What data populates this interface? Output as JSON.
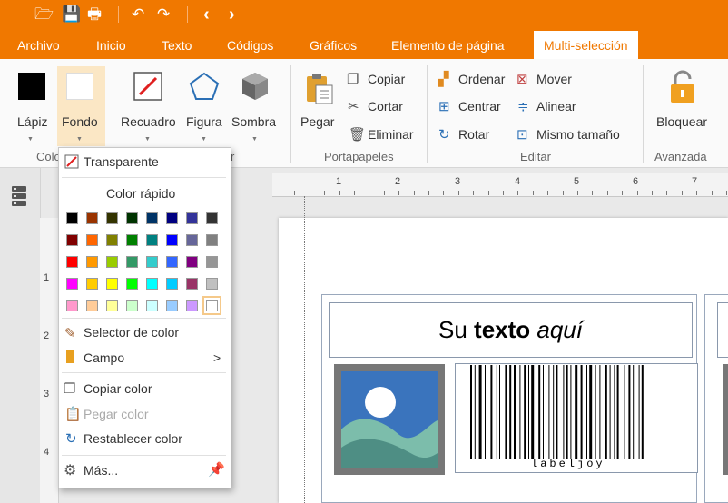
{
  "quick_access": {
    "icons": [
      "folder-open-icon",
      "save-icon",
      "print-icon",
      "undo-icon",
      "redo-icon",
      "back-icon",
      "forward-icon"
    ],
    "glyphs": [
      "🗁",
      "💾",
      "🖶",
      "↶",
      "↷",
      "‹",
      "›"
    ]
  },
  "tabs": [
    "Archivo",
    "Inicio",
    "Texto",
    "Códigos",
    "Gráficos",
    "Elemento de página",
    "Multi-selección"
  ],
  "ribbon": {
    "color_group": {
      "label": "Colo",
      "label_r": "r",
      "lapiz": "Lápiz",
      "fondo": "Fondo",
      "recuadro": "Recuadro",
      "figura": "Figura",
      "sombra": "Sombra"
    },
    "portapapeles": {
      "label": "Portapapeles",
      "pegar": "Pegar",
      "copiar": "Copiar",
      "cortar": "Cortar",
      "eliminar": "Eliminar"
    },
    "editar": {
      "label": "Editar",
      "ordenar": "Ordenar",
      "centrar": "Centrar",
      "rotar": "Rotar",
      "mover": "Mover",
      "alinear": "Alinear",
      "mismo_tamano": "Mismo tamaño"
    },
    "avanzada": {
      "label": "Avanzada",
      "bloquear": "Bloquear"
    }
  },
  "ruler": {
    "numbers": [
      "1",
      "2",
      "3",
      "4",
      "5",
      "6",
      "7"
    ]
  },
  "vruler_numbers": [
    "1",
    "2",
    "3",
    "4"
  ],
  "menu": {
    "transparente": "Transparente",
    "color_rapido": "Color rápido",
    "selector": "Selector de color",
    "campo": "Campo",
    "campo_arrow": ">",
    "copiar": "Copiar color",
    "pegar": "Pegar color",
    "restablecer": "Restablecer color",
    "mas": "Más..."
  },
  "palette": [
    [
      "#000000",
      "#993300",
      "#333300",
      "#003300",
      "#003366",
      "#000080",
      "#333399",
      "#333333"
    ],
    [
      "#800000",
      "#ff6600",
      "#808000",
      "#008000",
      "#008080",
      "#0000ff",
      "#666699",
      "#808080"
    ],
    [
      "#ff0000",
      "#ff9900",
      "#99cc00",
      "#339966",
      "#33cccc",
      "#3366ff",
      "#800080",
      "#969696"
    ],
    [
      "#ff00ff",
      "#ffcc00",
      "#ffff00",
      "#00ff00",
      "#00ffff",
      "#00ccff",
      "#993366",
      "#c0c0c0"
    ],
    [
      "#ff99cc",
      "#ffcc99",
      "#ffff99",
      "#ccffcc",
      "#ccffff",
      "#99ccff",
      "#cc99ff",
      "#ffffff"
    ]
  ],
  "label": {
    "text_plain": "Su ",
    "text_bold": "texto",
    "text_italic": "aquí",
    "barcode_text": "labeljoy"
  },
  "colors": {
    "accent": "#f07800",
    "lapiz": "#000000",
    "fondo": "#ffffff"
  }
}
